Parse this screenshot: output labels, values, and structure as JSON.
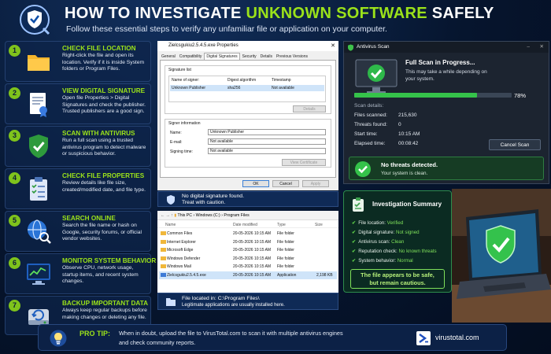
{
  "header": {
    "title_pre": "HOW TO INVESTIGATE ",
    "title_hl": "UNKNOWN SOFTWARE",
    "title_post": " SAFELY",
    "subtitle": "Follow these essential steps to verify any unfamiliar file or application on your computer."
  },
  "steps": [
    {
      "num": "1",
      "title": "CHECK FILE LOCATION",
      "desc": "Right-click the file and open its location. Verify if it is inside System folders or Program Files.",
      "icon": "folder-icon"
    },
    {
      "num": "2",
      "title": "VIEW DIGITAL SIGNATURE",
      "desc": "Open file Properties > Digital Signatures and check the publisher. Trusted publishers are a good sign.",
      "icon": "certificate-icon"
    },
    {
      "num": "3",
      "title": "SCAN WITH ANTIVIRUS",
      "desc": "Run a full scan using a trusted antivirus program to detect malware or suspicious behavior.",
      "icon": "shield-check-icon"
    },
    {
      "num": "4",
      "title": "CHECK FILE PROPERTIES",
      "desc": "Review details like file size, created/modified date, and file type.",
      "icon": "clipboard-icon"
    },
    {
      "num": "5",
      "title": "SEARCH ONLINE",
      "desc": "Search the file name or hash on Google, security forums, or official vendor websites.",
      "icon": "globe-search-icon"
    },
    {
      "num": "6",
      "title": "MONITOR SYSTEM BEHAVIOR",
      "desc": "Observe CPU, network usage, startup items, and recent system changes.",
      "icon": "monitor-chart-icon"
    },
    {
      "num": "7",
      "title": "BACKUP IMPORTANT DATA",
      "desc": "Always keep regular backups before making changes or deleting any file.",
      "icon": "backup-drive-icon"
    }
  ],
  "props": {
    "title": "Zielcsgukiu2.5.4.5.exe Properties",
    "tabs": [
      "General",
      "Compatibility",
      "Digital Signatures",
      "Security",
      "Details",
      "Previous Versions"
    ],
    "sig_list_label": "Signature list",
    "cols": [
      "Name of signer:",
      "Digest algorithm",
      "Timestamp"
    ],
    "row": [
      "Unknown Publisher",
      "sha256",
      "Not available"
    ],
    "details_btn": "Details",
    "signer_info": "Signer information",
    "name_label": "Name:",
    "name_val": "Unknown Publisher",
    "email_label": "E-mail:",
    "email_val": "Not available",
    "time_label": "Signing time:",
    "time_val": "Not available",
    "view_cert": "View Certificate",
    "ok": "OK",
    "cancel": "Cancel",
    "apply": "Apply",
    "caption1": "No digital signature found.",
    "caption2": "Treat with caution."
  },
  "explorer": {
    "path": [
      "This PC",
      "Windows (C:)",
      "Program Files"
    ],
    "cols": [
      "Name",
      "Date modified",
      "Type",
      "Size"
    ],
    "rows": [
      [
        "Common Files",
        "20-05-2026 10:15 AM",
        "File folder",
        ""
      ],
      [
        "Internet Explorer",
        "20-05-2026 10:15 AM",
        "File folder",
        ""
      ],
      [
        "Microsoft Edge",
        "20-05-2026 10:15 AM",
        "File folder",
        ""
      ],
      [
        "Windows Defender",
        "20-05-2026 10:15 AM",
        "File folder",
        ""
      ],
      [
        "Windows Mail",
        "20-05-2026 10:15 AM",
        "File folder",
        ""
      ],
      [
        "Zielcsgukiu2.5.4.5.exe",
        "20-05-2026 10:15 AM",
        "Application",
        "2,198 KB"
      ]
    ],
    "caption1": "File located in:  C:\\Program Files\\",
    "caption2": "Legitimate applications are usually installed here."
  },
  "antivirus": {
    "title": "Antivirus Scan",
    "heading": "Full Scan in Progress...",
    "sub": "This may take a while depending on your system.",
    "percent_label": "78%",
    "progress": 0.78,
    "details_label": "Scan details:",
    "rows": [
      [
        "Files scanned:",
        "215,630"
      ],
      [
        "Threats found:",
        "0"
      ],
      [
        "Start time:",
        "10:15 AM"
      ],
      [
        "Elapsed time:",
        "00:08:42"
      ]
    ],
    "cancel": "Cancel Scan",
    "result_title": "No threats detected.",
    "result_sub": "Your system is clean."
  },
  "summary": {
    "title": "Investigation Summary",
    "rows": [
      [
        "File location: ",
        "Verified"
      ],
      [
        "Digital signature: ",
        "Not signed"
      ],
      [
        "Antivirus scan: ",
        "Clean"
      ],
      [
        "Reputation check: ",
        "No known threats"
      ],
      [
        "System behavior: ",
        "Normal"
      ]
    ],
    "verdict1": "The file appears to be safe,",
    "verdict2": "but remain cautious."
  },
  "tip": {
    "label": "PRO TIP:",
    "text1": "When in doubt, upload the file to VirusTotal.com to scan it with multiple antivirus engines",
    "text2": "and check community reports.",
    "brand": "virustotal.com"
  },
  "colors": {
    "accent_green": "#9be21a",
    "bg_navy": "#06152e",
    "panel": "#0e244a"
  }
}
